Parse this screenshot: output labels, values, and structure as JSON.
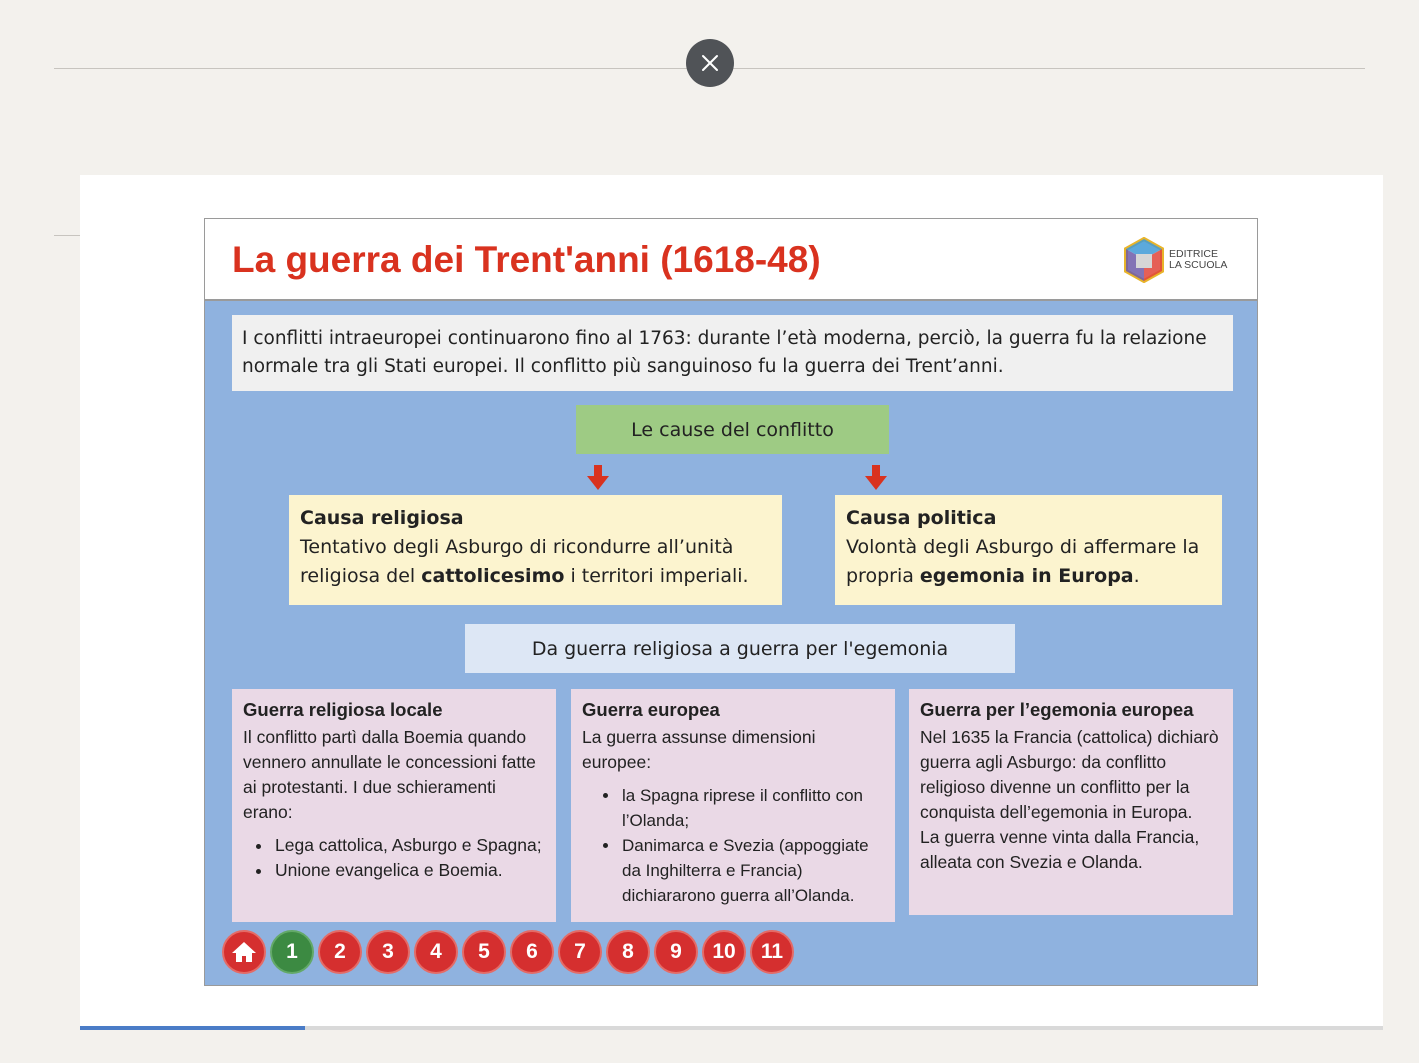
{
  "viewer": {
    "close_icon": "close-icon",
    "progress_fraction": 0.1727
  },
  "slide": {
    "title": "La guerra dei Trent'anni (1618-48)",
    "logo": {
      "line1": "EDITRICE",
      "line2": "LA SCUOLA",
      "icon": "hexagon-cube-logo"
    },
    "intro": "I conflitti intraeuropei continuarono fino al 1763: durante l’età moderna, perciò, la guerra fu la relazione normale tra gli Stati europei. Il conflitto più sanguinoso fu la guerra dei Trent’anni.",
    "causes_title": "Le cause del conflitto",
    "cause_religious": {
      "title": "Causa religiosa",
      "text_before": "Tentativo degli Asburgo di ricondurre all’unità religiosa del ",
      "text_bold": "cattolicesimo",
      "text_after": " i territori imperiali."
    },
    "cause_political": {
      "title": "Causa politica",
      "text_before": "Volontà degli Asburgo di affermare la propria ",
      "text_bold": "egemonia in Europa",
      "text_after": "."
    },
    "transition": "Da guerra religiosa a guerra per l'egemonia",
    "phase_local": {
      "title": "Guerra religiosa locale",
      "text": "Il conflitto partì dalla Boemia quando vennero annullate le concessioni fatte ai protestanti. I due schieramenti erano:",
      "items": [
        "Lega cattolica, Asburgo e Spagna;",
        "Unione evangelica e Boemia."
      ]
    },
    "phase_european": {
      "title": "Guerra europea",
      "text": "La guerra assunse dimensioni europee:",
      "items": [
        "la Spagna riprese il conflitto con l’Olanda;",
        "Danimarca e Svezia (appoggiate da Inghilterra e Francia) dichiararono guerra all’Olanda."
      ]
    },
    "phase_hegemony": {
      "title": "Guerra per l’egemonia europea",
      "text1": "Nel 1635 la Francia (cattolica) dichiarò guerra agli Asburgo: da conflitto religioso  divenne un conflitto per la conquista dell’egemonia in Europa.",
      "text2": "La guerra venne vinta dalla Francia, alleata con Svezia e Olanda."
    },
    "nav": {
      "home_icon": "home-icon",
      "current": "1",
      "pages": [
        "1",
        "2",
        "3",
        "4",
        "5",
        "6",
        "7",
        "8",
        "9",
        "10",
        "11"
      ]
    }
  },
  "colors": {
    "title_red": "#d9321f",
    "slide_bg": "#8fb2df",
    "causes_green": "#9ecb84",
    "cause_yellow": "#fcf4cf",
    "phase_pink": "#ead9e6",
    "nav_red": "#d52f2f",
    "nav_current_green": "#3c8a42",
    "progress_blue": "#4a7cc7"
  }
}
